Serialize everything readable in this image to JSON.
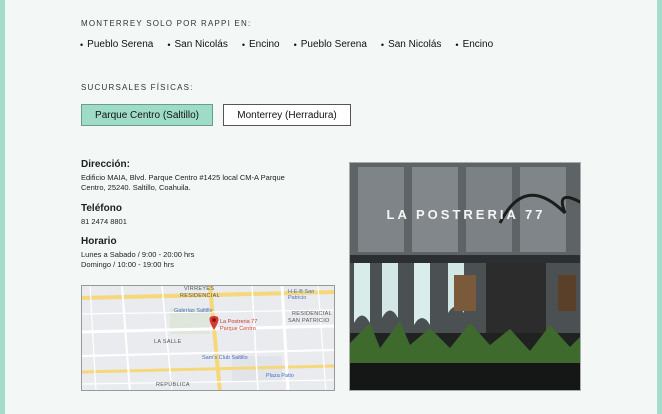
{
  "rappi": {
    "title": "MONTERREY SOLO POR RAPPI EN:",
    "items": [
      "Pueblo Serena",
      "San Nicolás",
      "Encino",
      "Pueblo Serena",
      "San Nicolás",
      "Encino"
    ]
  },
  "branches": {
    "title": "SUCURSALES FÍSICAS:",
    "buttons": [
      "Parque Centro (Saltillo)",
      "Monterrey (Herradura)"
    ],
    "selected": "Parque Centro (Saltillo)"
  },
  "details": {
    "address_heading": "Dirección:",
    "address_line1": "Edificio MAIA, Blvd. Parque Centro #1425 local CM-A Parque",
    "address_line2": "Centro, 25240. Saltillo, Coahuila.",
    "phone_heading": "Teléfono",
    "phone": "81 2474 8801",
    "hours_heading": "Horario",
    "hours_weekdays": "Lunes a Sabado  /  9:00 - 20:00 hrs",
    "hours_sunday": "Domingo  /  10:00 - 19:00 hrs"
  },
  "map": {
    "labels": [
      "VIRREYES",
      "RESIDENCIAL",
      "RESIDENCIAL",
      "SAN PATRICIO",
      "LA SALLE",
      "REPÚBLICA"
    ],
    "places": [
      "Galerías Saltillo",
      "H-E-B San Patricio",
      "Sam's Club Saltillo",
      "Plaza Patio"
    ],
    "pin_line1": "La Postreria 77",
    "pin_line2": "Parque Centro"
  },
  "photo": {
    "sign": "LA POSTRERIA 77"
  },
  "colors": {
    "accent": "#9fdcc8",
    "edge": "#a6dccb",
    "background": "#f3f8f6"
  }
}
